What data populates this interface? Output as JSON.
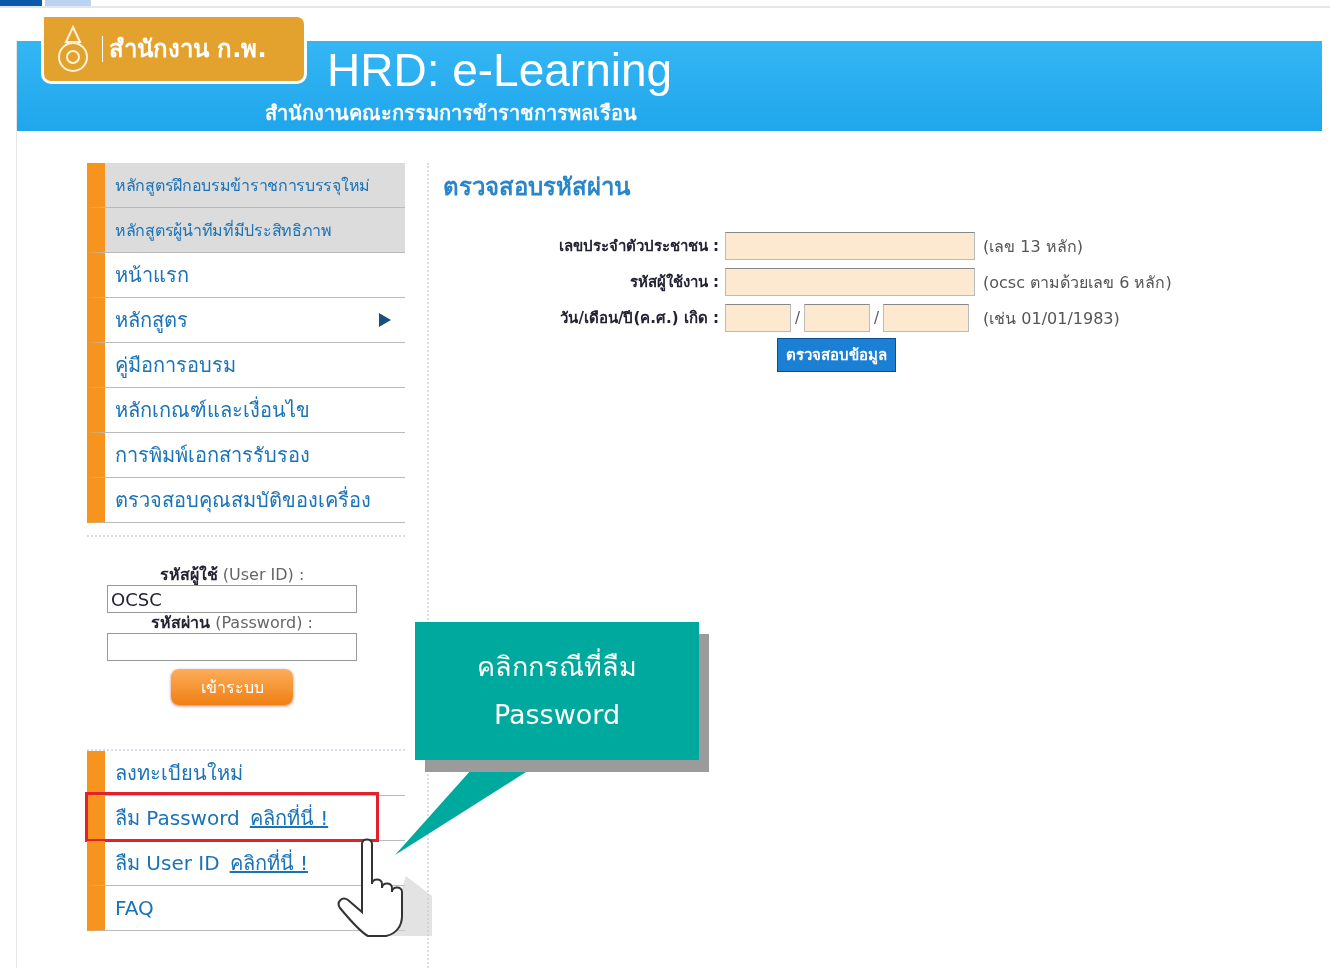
{
  "header": {
    "logo_title": "สำนักงาน ก.พ.",
    "title": "HRD: e-Learning",
    "subtitle": "สำนักงานคณะกรรมการข้าราชการพลเรือน"
  },
  "menu": [
    {
      "label": "หลักสูตรฝึกอบรมข้าราชการบรรจุใหม่",
      "kind": "featured"
    },
    {
      "label": "หลักสูตรผู้นำทีมที่มีประสิทธิภาพ",
      "kind": "featured"
    },
    {
      "label": "หน้าแรก",
      "kind": "plain"
    },
    {
      "label": "หลักสูตร",
      "kind": "submenu"
    },
    {
      "label": "คู่มือการอบรม",
      "kind": "plain"
    },
    {
      "label": "หลักเกณฑ์และเงื่อนไข",
      "kind": "plain"
    },
    {
      "label": "การพิมพ์เอกสารรับรอง",
      "kind": "plain"
    },
    {
      "label": "ตรวจสอบคุณสมบัติของเครื่อง",
      "kind": "plain"
    }
  ],
  "login": {
    "user_label": "**รหัสผู้ใช้** (User ID) :",
    "user_value": "OCSC",
    "password_label": "**รหัสผ่าน** (Password) :",
    "button": "เข้าระบบ"
  },
  "links": [
    {
      "label": "ลงทะเบียนใหม่",
      "highlighted": false
    },
    {
      "label": "ลืม Password",
      "link": "คลิกที่นี่ !",
      "highlighted": true
    },
    {
      "label": "ลืม User ID",
      "link": "คลิกที่นี่ !",
      "highlighted": false
    },
    {
      "label": "FAQ",
      "highlighted": false
    }
  ],
  "form": {
    "title": "ตรวจสอบรหัสผ่าน",
    "rows": [
      {
        "kind": "text",
        "label": "เลขประจำตัวประชาชน :",
        "hint": "(เลข 13 หลัก)"
      },
      {
        "kind": "text",
        "label": "รหัสผู้ใช้งาน :",
        "hint": "(ocsc ตามด้วยเลข 6 หลัก)"
      },
      {
        "kind": "date",
        "label": "วัน/เดือน/ปี(ค.ศ.) เกิด :",
        "separators": [
          "/",
          "/"
        ],
        "hint": "(เช่น 01/01/1983)"
      }
    ],
    "button": "ตรวจสอบข้อมูล"
  },
  "callout": {
    "lines": [
      "คลิกกรณีที่ลืม",
      "Password"
    ]
  }
}
